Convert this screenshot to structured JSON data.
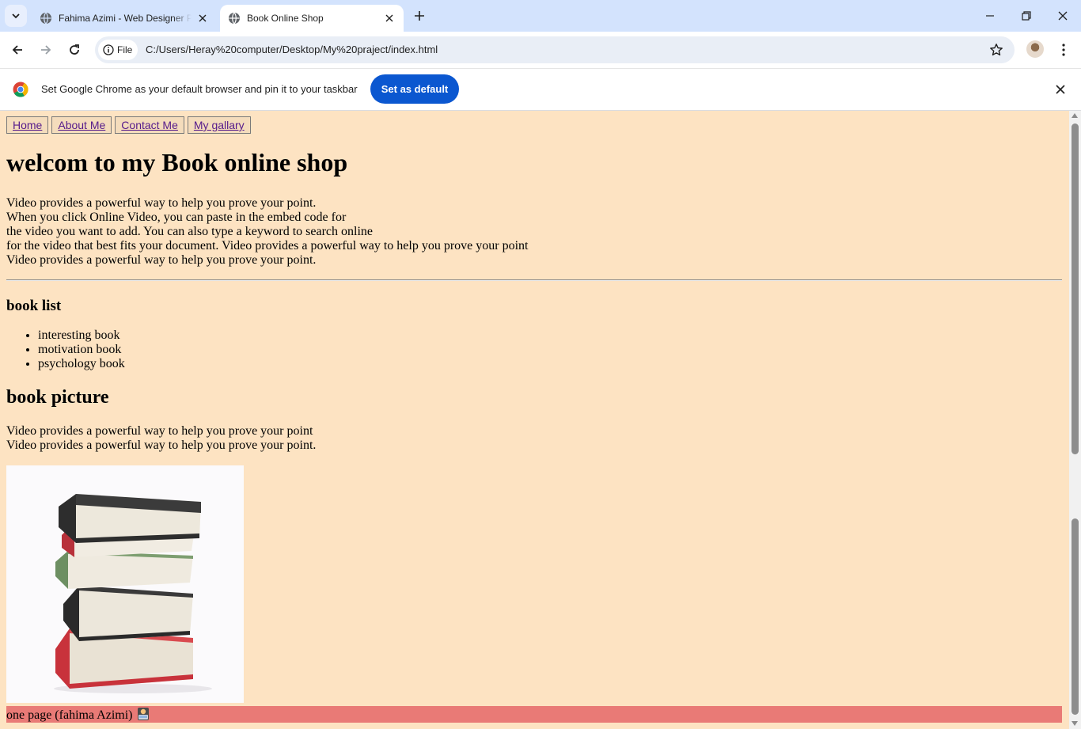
{
  "browser": {
    "tabs": [
      {
        "title": "Fahima Azimi - Web Designer Portfolio",
        "active": false
      },
      {
        "title": "Book Online Shop",
        "active": true
      }
    ],
    "site_chip": "File",
    "url": "C:/Users/Heray%20computer/Desktop/My%20praject/index.html",
    "infobar_text": "Set Google Chrome as your default browser and pin it to your taskbar",
    "set_default_label": "Set as default"
  },
  "page": {
    "nav": [
      "Home",
      "About Me",
      "Contact Me",
      "My gallary"
    ],
    "title": "welcom to my Book online shop",
    "intro_lines": [
      "Video provides a powerful way to help you prove your point.",
      "When you click Online Video, you can paste in the embed code for",
      "the video you want to add. You can also type a keyword to search online",
      "for the video that best fits your document. Video provides a powerful way to help you prove your point",
      "Video provides a powerful way to help you prove your point."
    ],
    "book_list_heading": "book list",
    "books": [
      "interesting book",
      "motivation book",
      "psychology book"
    ],
    "book_picture_heading": "book picture",
    "picture_lines": [
      "Video provides a powerful way to help you prove your point",
      "Video provides a powerful way to help you prove your point."
    ],
    "footer_text": "one page (fahima Azimi)"
  },
  "colors": {
    "page_background": "#fde3c2",
    "footer_background": "#e97a76",
    "tabstrip": "#d3e3fd",
    "accent_button": "#0b57d0",
    "visited_link": "#551a8b"
  }
}
